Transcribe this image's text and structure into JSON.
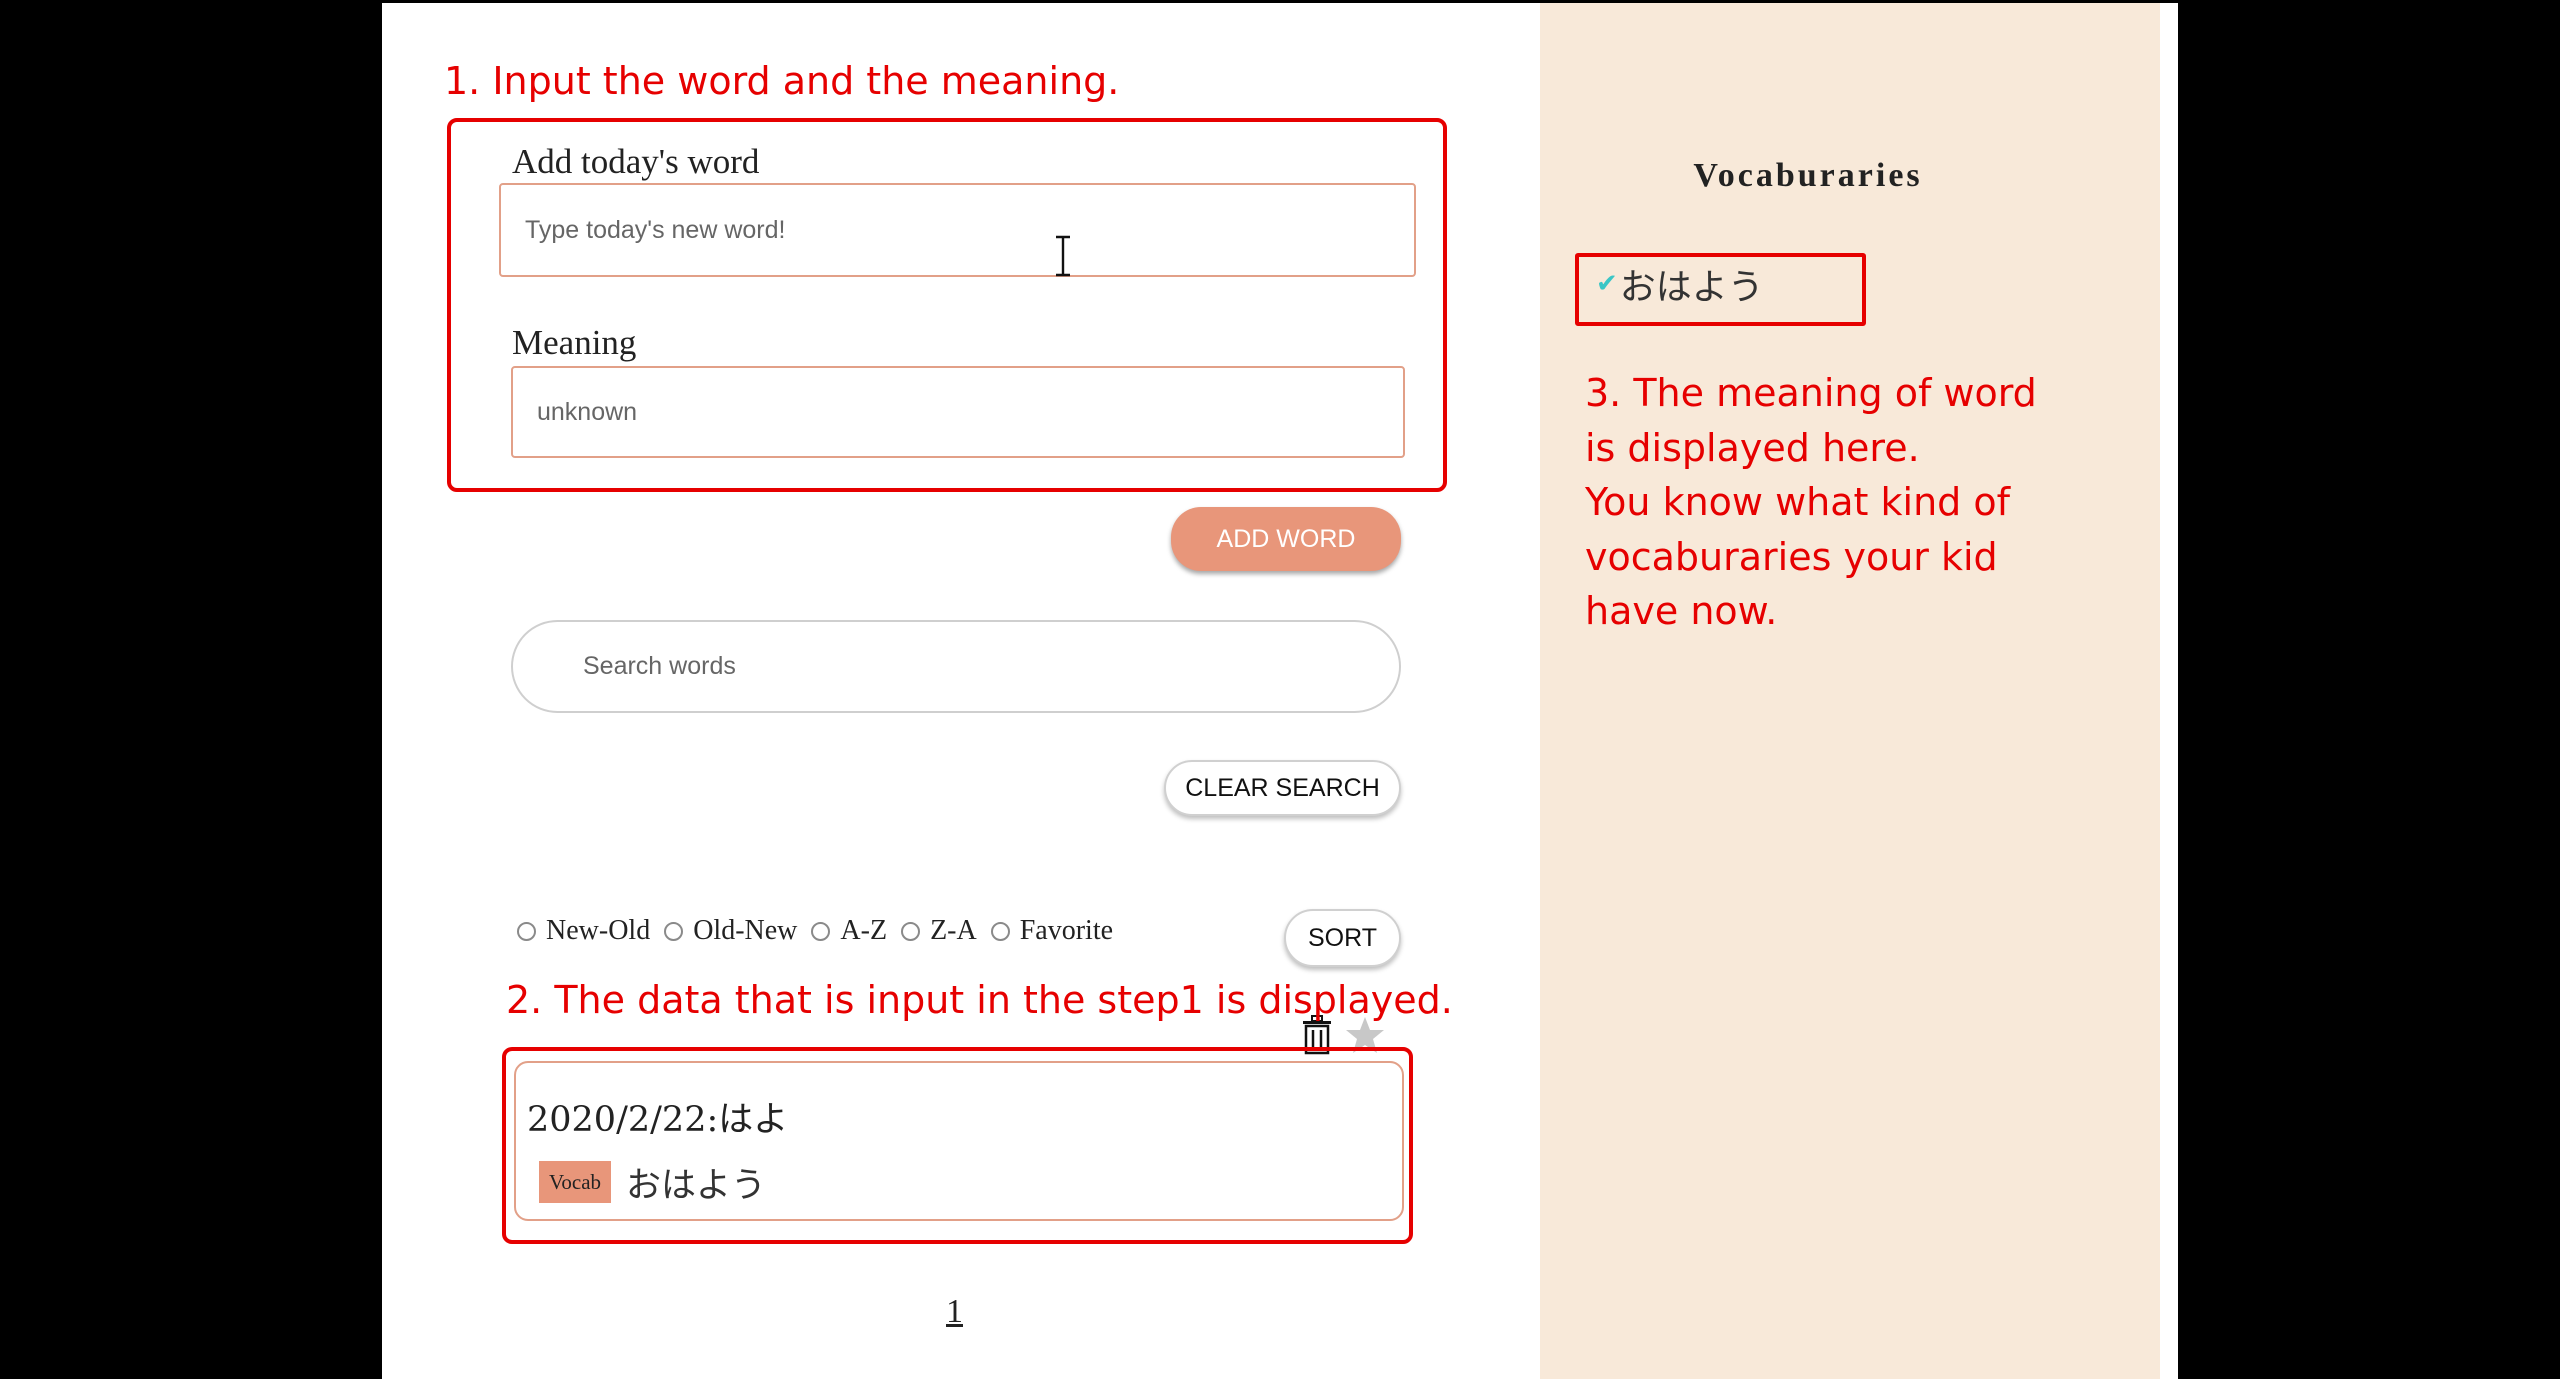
{
  "form": {
    "word_label": "Add today's word",
    "word_placeholder": "Type today's new word!",
    "meaning_label": "Meaning",
    "meaning_placeholder": "unknown",
    "add_button": "ADD WORD"
  },
  "search": {
    "placeholder": "Search words",
    "clear_button": "CLEAR SEARCH"
  },
  "sort": {
    "options": [
      "New-Old",
      "Old-New",
      "A-Z",
      "Z-A",
      "Favorite"
    ],
    "button": "SORT"
  },
  "entries": [
    {
      "date_word": "2020/2/22:はよ",
      "tag": "Vocab",
      "meaning": "おはよう"
    }
  ],
  "pagination": {
    "current": "1"
  },
  "sidebar": {
    "title": "Vocaburaries",
    "items": [
      {
        "check": "✔",
        "label": "おはよう"
      }
    ]
  },
  "annotations": {
    "step1": "1. Input the word and the meaning.",
    "step2": "2. The data that is input in the step1 is displayed.",
    "step3_lines": [
      "3. The meaning of word",
      "is displayed here.",
      "You know what kind of",
      "vocaburaries your kid",
      "have now."
    ]
  },
  "colors": {
    "accent": "#e8967a",
    "panel_bg": "#f8e9d9",
    "annotation": "#e60000",
    "check": "#3bc6c6"
  },
  "icons": [
    "trash-icon",
    "star-icon",
    "check-icon",
    "text-cursor-icon"
  ]
}
